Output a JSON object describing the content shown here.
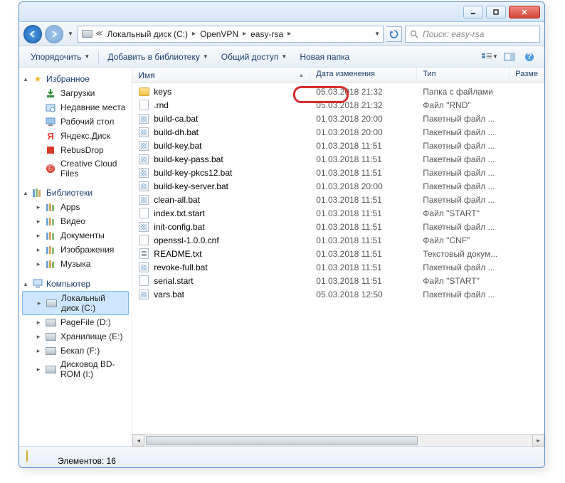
{
  "window": {
    "min": "–",
    "max": "□",
    "close": "✕"
  },
  "breadcrumbs": [
    {
      "label": "Локальный диск (C:)"
    },
    {
      "label": "OpenVPN"
    },
    {
      "label": "easy-rsa"
    }
  ],
  "breadcrumb_icon": "drive-icon",
  "search": {
    "placeholder": "Поиск: easy-rsa"
  },
  "toolbar": {
    "organize": "Упорядочить",
    "addlib": "Добавить в библиотеку",
    "share": "Общий доступ",
    "newfolder": "Новая папка"
  },
  "sidebar": {
    "favorites": {
      "label": "Избранное",
      "items": [
        {
          "label": "Загрузки",
          "icon": "download"
        },
        {
          "label": "Недавние места",
          "icon": "recent"
        },
        {
          "label": "Рабочий стол",
          "icon": "desktop"
        },
        {
          "label": "Яндекс.Диск",
          "icon": "yandex"
        },
        {
          "label": "RebusDrop",
          "icon": "rebus"
        },
        {
          "label": "Creative Cloud Files",
          "icon": "cc"
        }
      ]
    },
    "libraries": {
      "label": "Библиотеки",
      "items": [
        {
          "label": "Apps"
        },
        {
          "label": "Видео"
        },
        {
          "label": "Документы"
        },
        {
          "label": "Изображения"
        },
        {
          "label": "Музыка"
        }
      ]
    },
    "computer": {
      "label": "Компьютер",
      "items": [
        {
          "label": "Локальный диск (C:)",
          "selected": true
        },
        {
          "label": "PageFile (D:)"
        },
        {
          "label": "Хранилище (E:)"
        },
        {
          "label": "Бекап (F:)"
        },
        {
          "label": "Дисковод BD-ROM (I:)"
        }
      ]
    }
  },
  "columns": {
    "name": "Имя",
    "date": "Дата изменения",
    "type": "Тип",
    "size": "Разме"
  },
  "files": [
    {
      "name": "keys",
      "date": "05.03.2018 21:32",
      "type": "Папка с файлами",
      "icon": "folder",
      "highlighted": true
    },
    {
      "name": ".rnd",
      "date": "05.03.2018 21:32",
      "type": "Файл \"RND\"",
      "icon": "file"
    },
    {
      "name": "build-ca.bat",
      "date": "01.03.2018 20:00",
      "type": "Пакетный файл ...",
      "icon": "bat"
    },
    {
      "name": "build-dh.bat",
      "date": "01.03.2018 20:00",
      "type": "Пакетный файл ...",
      "icon": "bat"
    },
    {
      "name": "build-key.bat",
      "date": "01.03.2018 11:51",
      "type": "Пакетный файл ...",
      "icon": "bat"
    },
    {
      "name": "build-key-pass.bat",
      "date": "01.03.2018 11:51",
      "type": "Пакетный файл ...",
      "icon": "bat"
    },
    {
      "name": "build-key-pkcs12.bat",
      "date": "01.03.2018 11:51",
      "type": "Пакетный файл ...",
      "icon": "bat"
    },
    {
      "name": "build-key-server.bat",
      "date": "01.03.2018 20:00",
      "type": "Пакетный файл ...",
      "icon": "bat"
    },
    {
      "name": "clean-all.bat",
      "date": "01.03.2018 11:51",
      "type": "Пакетный файл ...",
      "icon": "bat"
    },
    {
      "name": "index.txt.start",
      "date": "01.03.2018 11:51",
      "type": "Файл \"START\"",
      "icon": "file"
    },
    {
      "name": "init-config.bat",
      "date": "01.03.2018 11:51",
      "type": "Пакетный файл ...",
      "icon": "bat"
    },
    {
      "name": "openssl-1.0.0.cnf",
      "date": "01.03.2018 11:51",
      "type": "Файл \"CNF\"",
      "icon": "file"
    },
    {
      "name": "README.txt",
      "date": "01.03.2018 11:51",
      "type": "Текстовый докум...",
      "icon": "txt"
    },
    {
      "name": "revoke-full.bat",
      "date": "01.03.2018 11:51",
      "type": "Пакетный файл ...",
      "icon": "bat"
    },
    {
      "name": "serial.start",
      "date": "01.03.2018 11:51",
      "type": "Файл \"START\"",
      "icon": "file"
    },
    {
      "name": "vars.bat",
      "date": "05.03.2018 12:50",
      "type": "Пакетный файл ...",
      "icon": "bat"
    }
  ],
  "status": {
    "text": "Элементов: 16"
  }
}
